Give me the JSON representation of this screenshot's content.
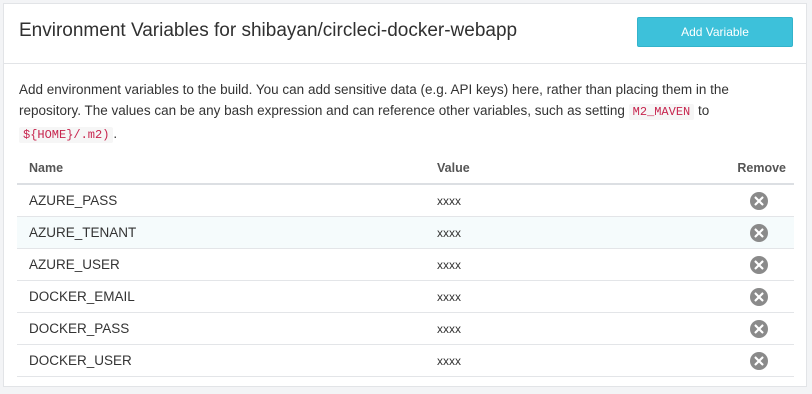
{
  "panel": {
    "title": "Environment Variables for shibayan/circleci-docker-webapp",
    "add_button_label": "Add Variable"
  },
  "description": {
    "text_before": "Add environment variables to the build. You can add sensitive data (e.g. API keys) here, rather than placing them in the repository. The values can be any bash expression and can reference other variables, such as setting",
    "code_var": "M2_MAVEN",
    "text_to": "to",
    "code_value": "${HOME}/.m2)",
    "text_end": "."
  },
  "table": {
    "headers": {
      "name": "Name",
      "value": "Value",
      "remove": "Remove"
    },
    "rows": [
      {
        "name": "AZURE_PASS",
        "value": "xxxx"
      },
      {
        "name": "AZURE_TENANT",
        "value": "xxxx"
      },
      {
        "name": "AZURE_USER",
        "value": "xxxx"
      },
      {
        "name": "DOCKER_EMAIL",
        "value": "xxxx"
      },
      {
        "name": "DOCKER_PASS",
        "value": "xxxx"
      },
      {
        "name": "DOCKER_USER",
        "value": "xxxx"
      }
    ]
  },
  "icons": {
    "remove": "close-circle-icon"
  },
  "colors": {
    "accent": "#3dc1da",
    "code_text": "#c7254e",
    "remove_icon": "#8a8a8a",
    "row_highlight": "#f5fbfc"
  }
}
